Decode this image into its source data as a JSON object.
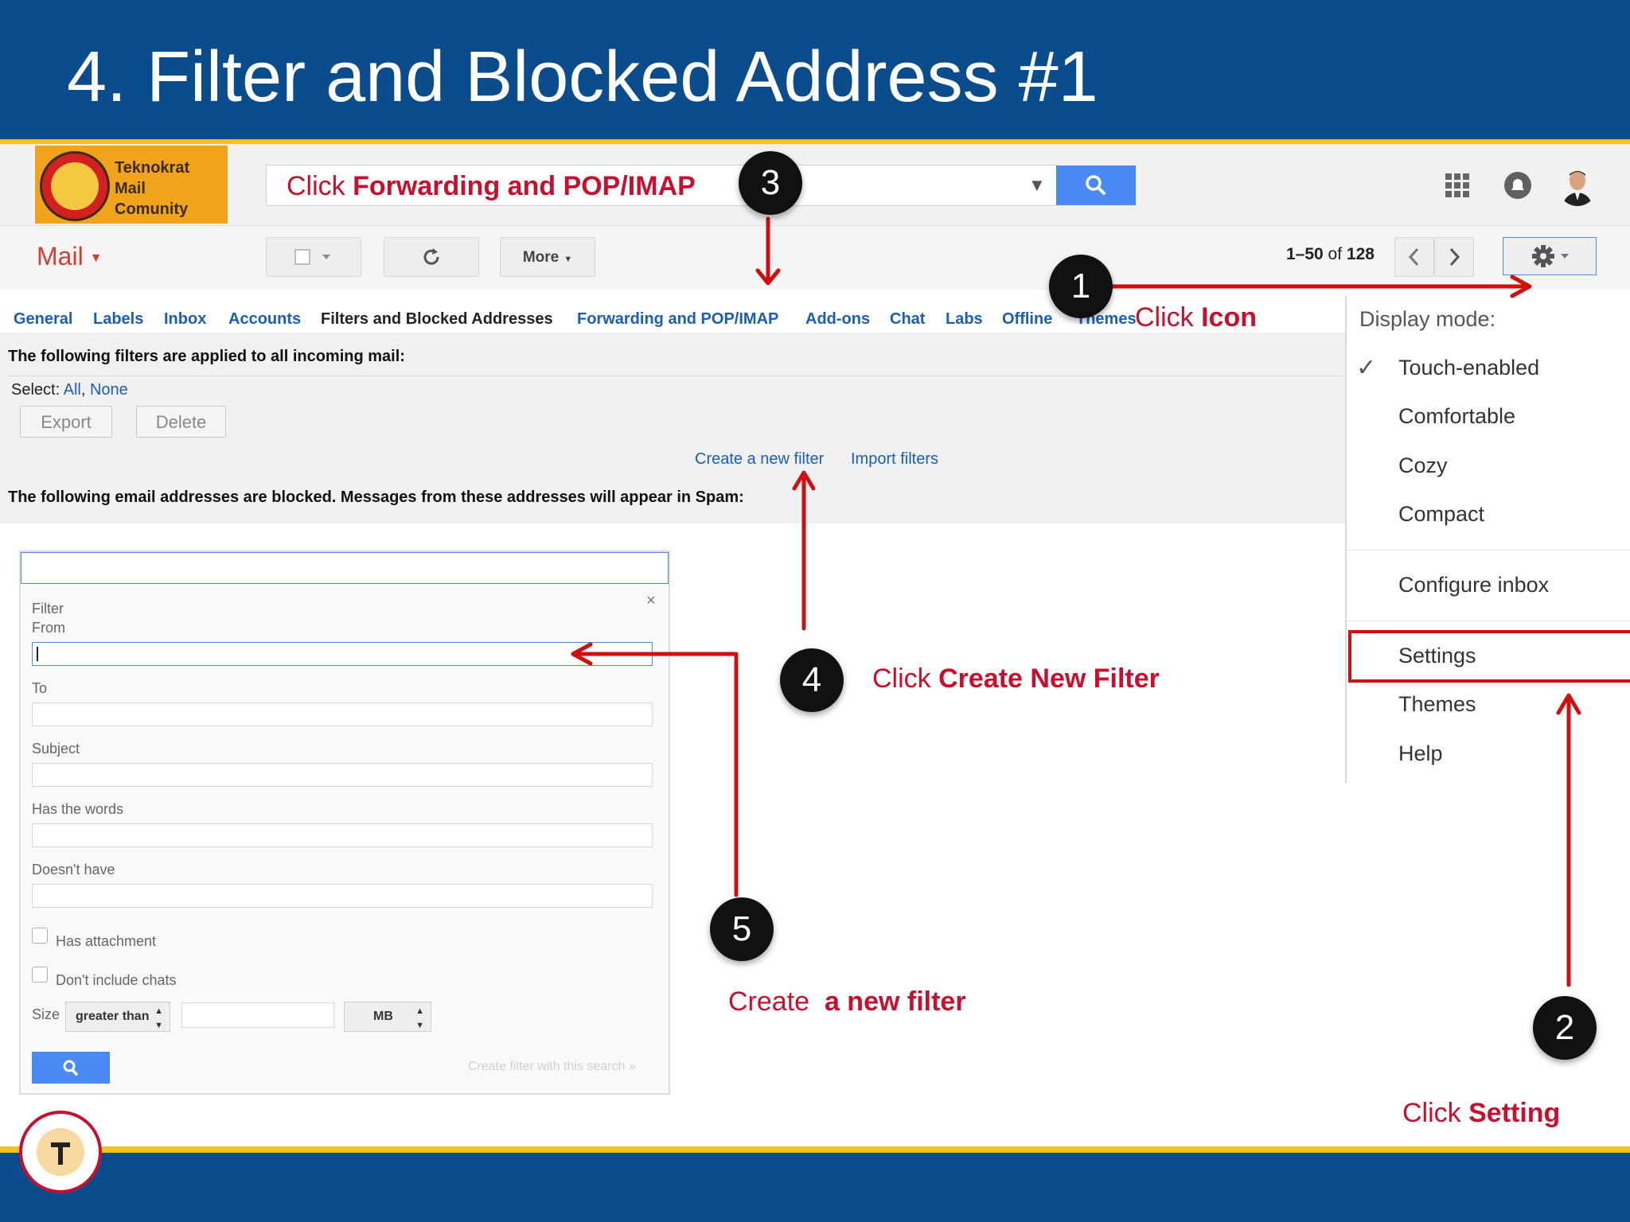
{
  "slide": {
    "title": "4. Filter and Blocked Address #1"
  },
  "logo": {
    "line1": "Teknokrat",
    "line2": "Mail",
    "line3": "Comunity"
  },
  "search": {
    "prefix": "Click ",
    "bold": "Forwarding and POP/IMAP"
  },
  "toolbar": {
    "mail_label": "Mail",
    "more_label": "More",
    "pagination_range": "1–50",
    "pagination_of": " of ",
    "pagination_total": "128"
  },
  "tabs": [
    "General",
    "Labels",
    "Inbox",
    "Accounts",
    "Filters and Blocked Addresses",
    "Forwarding and POP/IMAP",
    "Add-ons",
    "Chat",
    "Labs",
    "Offline",
    "Themes"
  ],
  "filters": {
    "heading": "The following filters are applied to all incoming mail:",
    "select_label": "Select: ",
    "select_all": "All",
    "select_sep": ", ",
    "select_none": "None",
    "export_label": "Export",
    "delete_label": "Delete",
    "create_filter_link": "Create a new filter",
    "import_filters_link": "Import filters",
    "blocked_heading": "The following email addresses are blocked. Messages from these addresses will appear in Spam:"
  },
  "menu": {
    "display_mode": "Display mode:",
    "touch_enabled": "Touch-enabled",
    "comfortable": "Comfortable",
    "cozy": "Cozy",
    "compact": "Compact",
    "configure_inbox": "Configure inbox",
    "settings": "Settings",
    "themes": "Themes",
    "help": "Help"
  },
  "filter_dialog": {
    "filter_label": "Filter",
    "from_label": "From",
    "to_label": "To",
    "subject_label": "Subject",
    "has_words_label": "Has the words",
    "doesnt_have_label": "Doesn't have",
    "has_attachment_label": "Has attachment",
    "dont_include_chats_label": "Don't include chats",
    "size_label": "Size",
    "size_comparator": "greater than",
    "size_unit": "MB",
    "close_glyph": "×",
    "create_with_search": "Create filter with this search »"
  },
  "annotations": {
    "step1": "1",
    "step2": "2",
    "step3": "3",
    "step4": "4",
    "step5": "5",
    "click_icon_prefix": "Click ",
    "click_icon_bold": "Icon",
    "create_filter_prefix": "Click ",
    "create_filter_bold": "Create New Filter",
    "new_filter_prefix": "Create  ",
    "new_filter_bold": "a new filter",
    "setting_prefix": "Click ",
    "setting_bold": "Setting"
  },
  "colors": {
    "slide_blue": "#0b4c8c",
    "accent_yellow": "#f4c21a",
    "annotation_red": "#c8102e",
    "link_blue": "#1a5fb4",
    "gmail_button_blue": "#4a8af4"
  },
  "icons": [
    "search-icon",
    "chevron-down-icon",
    "apps-grid-icon",
    "notification-icon",
    "checkbox-icon",
    "refresh-icon",
    "chevron-left-icon",
    "chevron-right-icon",
    "gear-icon",
    "check-icon",
    "close-icon",
    "updown-arrows-icon"
  ]
}
